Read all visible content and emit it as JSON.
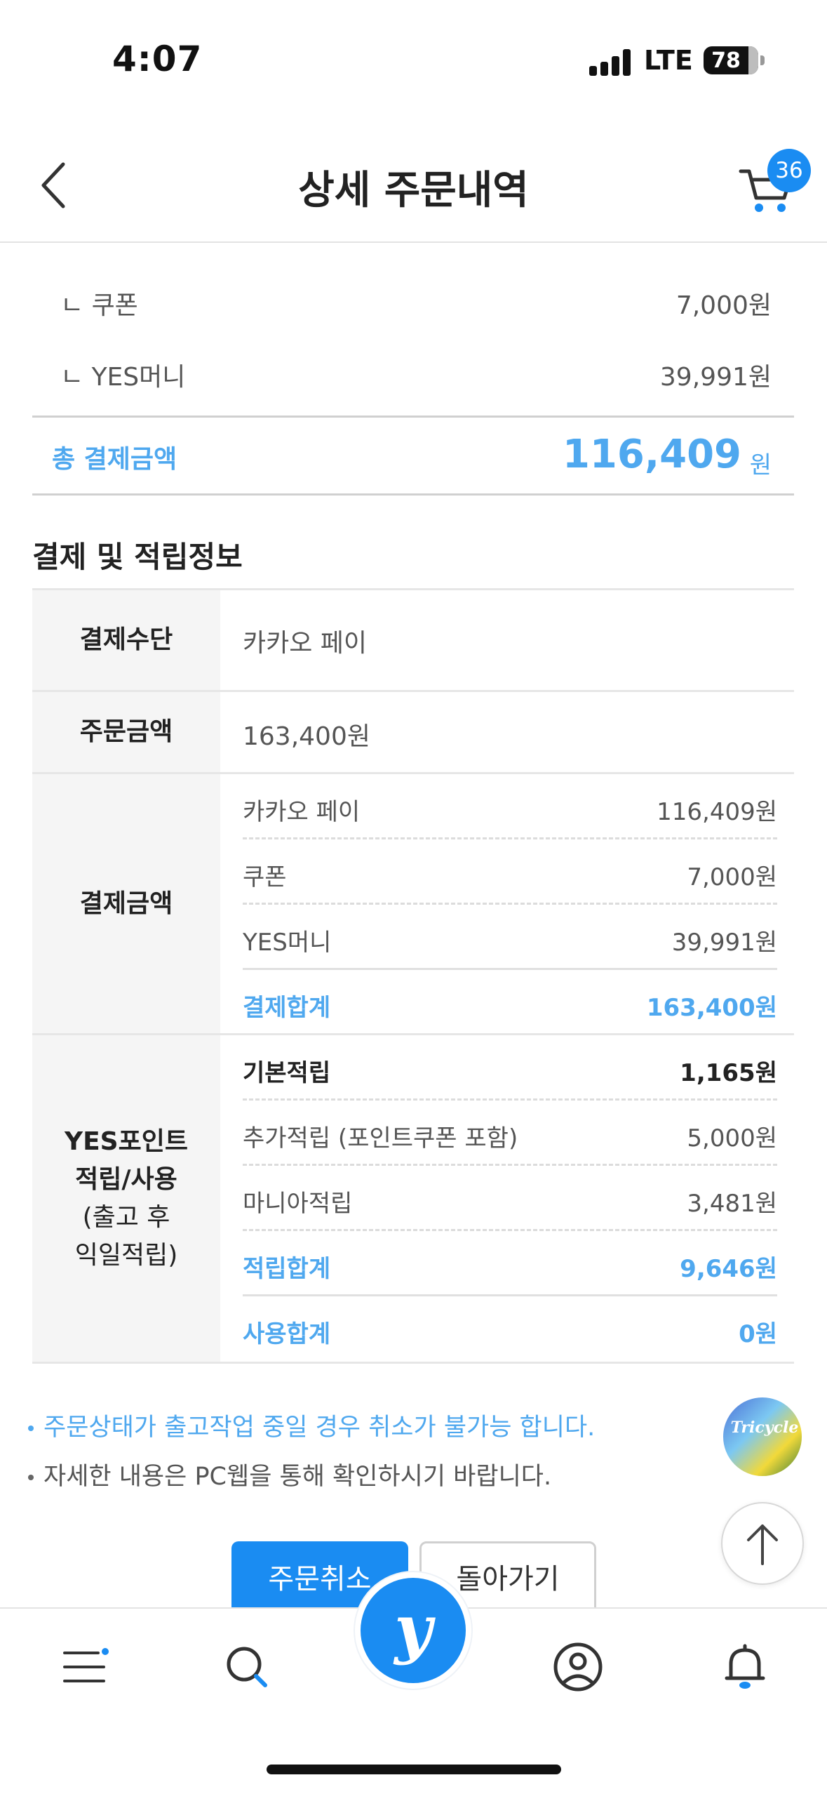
{
  "status_bar": {
    "time": "4:07",
    "network": "LTE",
    "battery": "78",
    "battery_level": 0.78
  },
  "header": {
    "title": "상세 주문내역",
    "cart_count": "36"
  },
  "summary": {
    "sub_items": [
      {
        "label": "ㄴ 쿠폰",
        "value": "7,000원"
      },
      {
        "label": "ㄴ YES머니",
        "value": "39,991원"
      }
    ],
    "total_label": "총 결제금액",
    "total_amount": "116,409",
    "total_unit": "원"
  },
  "payment_info": {
    "section_title": "결제 및 적립정보",
    "method_label": "결제수단",
    "method_value": "카카오 페이",
    "order_amount_label": "주문금액",
    "order_amount_value": "163,400원",
    "paid_label": "결제금액",
    "paid_items": [
      {
        "label": "카카오 페이",
        "value": "116,409원"
      },
      {
        "label": "쿠폰",
        "value": "7,000원"
      },
      {
        "label": "YES머니",
        "value": "39,991원"
      }
    ],
    "paid_total_label": "결제합계",
    "paid_total_value": "163,400원",
    "points_label_line1": "YES포인트",
    "points_label_line2": "적립/사용",
    "points_label_line3": "(출고 후",
    "points_label_line4": "익일적립)",
    "points_items": [
      {
        "label": "기본적립",
        "value": "1,165원"
      },
      {
        "label": "추가적립 (포인트쿠폰 포함)",
        "value": "5,000원"
      },
      {
        "label": "마니아적립",
        "value": "3,481원"
      }
    ],
    "points_total_label": "적립합계",
    "points_total_value": "9,646원",
    "used_total_label": "사용합계",
    "used_total_value": "0원"
  },
  "notes": [
    "주문상태가 출고작업 중일 경우 취소가 불가능 합니다.",
    "자세한 내용은 PC웹을 통해 확인하시기 바랍니다."
  ],
  "floating": {
    "thumb_text": "Tricycle",
    "thumb_icon": "album-thumbnail",
    "top_icon": "arrow-up-icon"
  },
  "buttons": {
    "cancel": "주문취소",
    "back": "돌아가기"
  },
  "tabbar": {
    "items": [
      "menu-icon",
      "search-icon",
      "yes24-home",
      "my-page-icon",
      "bell-icon"
    ],
    "fab_label": "y"
  },
  "colors": {
    "accent": "#1a8cf2",
    "accent_text": "#4fa8ef"
  }
}
